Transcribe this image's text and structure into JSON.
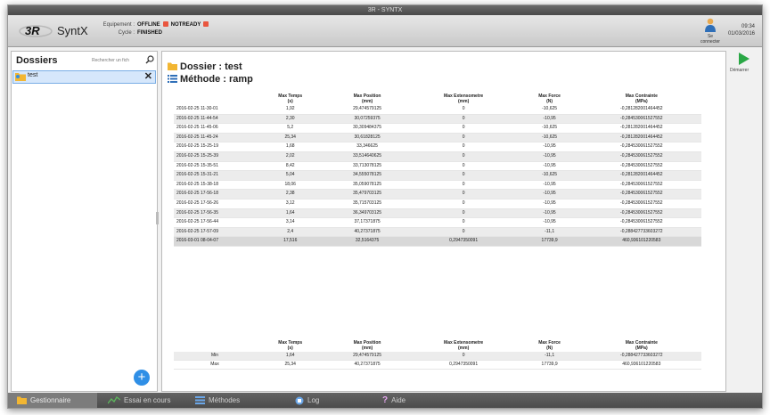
{
  "window": {
    "title": "3R - SYNTX"
  },
  "header": {
    "app_name": "SyntX",
    "equipment_label": "Equipement :",
    "equipment_value": "OFFLINE",
    "ready_value": "NOTREADY",
    "cycle_label": "Cycle :",
    "cycle_value": "FINISHED",
    "user_label": "Se connecter",
    "time": "09:34",
    "date": "01/03/2016"
  },
  "sidebar": {
    "title": "Dossiers",
    "search_placeholder": "Rechercher un fich",
    "folders": [
      {
        "name": "test"
      }
    ]
  },
  "main": {
    "dossier_label": "Dossier : test",
    "methode_label": "Méthode : ramp",
    "columns": [
      "",
      "Max Temps\n(s)",
      "Max Position\n(mm)",
      "Max Extensometre\n(mm)",
      "Max Force\n(N)",
      "Max Contrainte\n(MPa)"
    ],
    "rows": [
      [
        "2016-02-25 11-30-01",
        "1,92",
        "29,474579125",
        "0",
        "-10,625",
        "-0,281282001464452"
      ],
      [
        "2016-02-25 11-44-54",
        "2,30",
        "30,07259375",
        "0",
        "-10,95",
        "-0,284530061527552"
      ],
      [
        "2016-02-25 11-45-06",
        "5,2",
        "30,309484375",
        "0",
        "-10,625",
        "-0,281282001464452"
      ],
      [
        "2016-02-25 11-45-24",
        "25,34",
        "30,61828125",
        "0",
        "-10,625",
        "-0,281282001464452"
      ],
      [
        "2016-02-25 15-25-19",
        "1,68",
        "33,346625",
        "0",
        "-10,95",
        "-0,284530061527552"
      ],
      [
        "2016-02-25 15-25-39",
        "2,02",
        "33,514640625",
        "0",
        "-10,95",
        "-0,284530061527552"
      ],
      [
        "2016-02-25 15-35-51",
        "8,42",
        "33,713078125",
        "0",
        "-10,95",
        "-0,284530061527552"
      ],
      [
        "2016-02-25 15-31-21",
        "5,04",
        "34,555078125",
        "0",
        "-10,625",
        "-0,281282001464452"
      ],
      [
        "2016-02-25 15-38-18",
        "18,06",
        "35,059078125",
        "0",
        "-10,95",
        "-0,284530061527552"
      ],
      [
        "2016-02-25 17-56-18",
        "2,38",
        "35,479703125",
        "0",
        "-10,95",
        "-0,284530061527552"
      ],
      [
        "2016-02-25 17-56-26",
        "3,12",
        "35,715703125",
        "0",
        "-10,95",
        "-0,284530061527552"
      ],
      [
        "2016-02-25 17-56-35",
        "1,64",
        "36,349703125",
        "0",
        "-10,95",
        "-0,284530061527552"
      ],
      [
        "2016-02-25 17-56-44",
        "3,14",
        "37,17371875",
        "0",
        "-10,95",
        "-0,284530061527552"
      ],
      [
        "2016-02-25 17-57-09",
        "2,4",
        "40,27371875",
        "0",
        "-11,1",
        "-0,288427733603272"
      ],
      [
        "2016-03-01 08-04-07",
        "17,516",
        "32,5164375",
        "0,2947350091",
        "17739,9",
        "460,936101220583"
      ]
    ],
    "stats": [
      [
        "Min",
        "1,64",
        "29,474579125",
        "0",
        "-11,1",
        "-0,288427733603272"
      ],
      [
        "Max",
        "25,34",
        "40,27371875",
        "0,2947350091",
        "17739,9",
        "460,936101220583"
      ]
    ]
  },
  "right_panel": {
    "start_label": "Démarrer"
  },
  "bottom_tabs": [
    "Gestionnaire",
    "Essai en cours",
    "Méthodes",
    "Log",
    "Aide"
  ],
  "colors": {
    "accent": "#2f8fe6",
    "offline": "#e9563f",
    "start": "#29a745",
    "folder": "#f2b632"
  }
}
